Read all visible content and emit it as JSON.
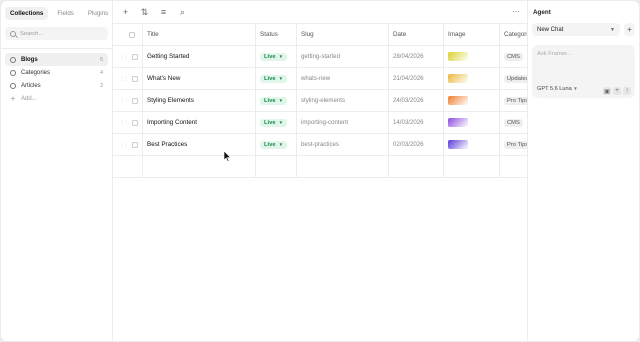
{
  "nav": {
    "tabs": [
      "Collections",
      "Fields",
      "Plugins"
    ],
    "search_placeholder": "Search..."
  },
  "sidebar": {
    "items": [
      {
        "label": "Blogs",
        "count": "5",
        "icon": "stack-icon",
        "active": true
      },
      {
        "label": "Categories",
        "count": "4",
        "icon": "tag-icon",
        "active": false
      },
      {
        "label": "Articles",
        "count": "3",
        "icon": "article-icon",
        "active": false
      }
    ],
    "add_label": "Add..."
  },
  "toolbar": {
    "icons": [
      "plus-icon",
      "sort-icon",
      "filter-icon",
      "search-icon"
    ],
    "more": "···"
  },
  "table": {
    "columns": [
      "Title",
      "Status",
      "Slug",
      "Date",
      "Image",
      "Categorie"
    ],
    "rows": [
      {
        "title": "Getting Started",
        "status": "Live",
        "slug": "getting-started",
        "date": "28/04/2026",
        "image_color": "#d9d12a",
        "category": "CMS"
      },
      {
        "title": "What's New",
        "status": "Live",
        "slug": "whats-new",
        "date": "21/04/2026",
        "image_color": "#e9b83a",
        "category": "Updates"
      },
      {
        "title": "Styling Elements",
        "status": "Live",
        "slug": "styling-elements",
        "date": "24/03/2026",
        "image_color": "#f07d2c",
        "category": "Pro Tips"
      },
      {
        "title": "Importing Content",
        "status": "Live",
        "slug": "importing-content",
        "date": "14/03/2026",
        "image_color": "#8c4de0",
        "category": "CMS"
      },
      {
        "title": "Best Practices",
        "status": "Live",
        "slug": "best-practices",
        "date": "02/03/2026",
        "image_color": "#5a3ad9",
        "category": "Pro Tips"
      }
    ]
  },
  "agent": {
    "title": "Agent",
    "chat_selected": "New Chat",
    "input_placeholder": "Ask Framer...",
    "model": "GPT 5.6 Luna"
  },
  "colors": {
    "live_bg": "#e0f6ea",
    "live_text": "#198a4b",
    "accent": "#111111"
  }
}
